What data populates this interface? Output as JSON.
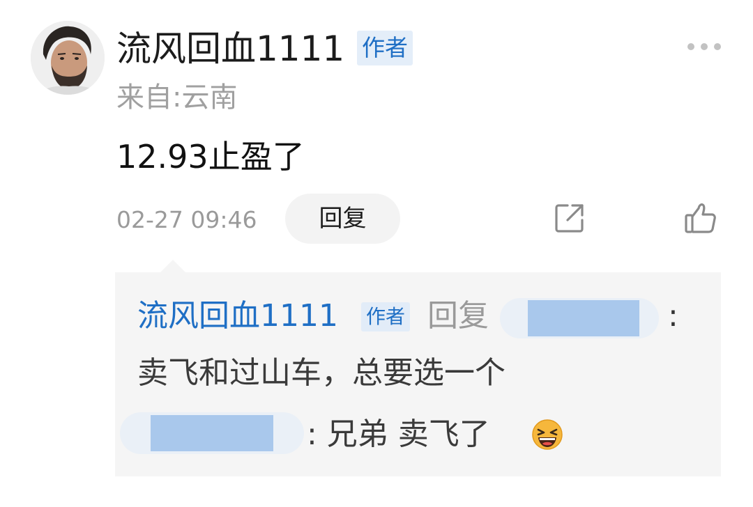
{
  "post": {
    "username": "流风回血1111",
    "author_tag": "作者",
    "location": "来自:云南",
    "content": "12.93止盈了",
    "timestamp": "02-27 09:46",
    "reply_label": "回复"
  },
  "icons": {
    "more": "more-dots-icon",
    "share": "share-icon",
    "like": "thumbs-up-icon",
    "emoji": "laughing-emoji-icon"
  },
  "replies": [
    {
      "username": "流风回血1111",
      "author_tag": "作者",
      "verb": "回复",
      "colon": ":",
      "text": "卖飞和过山车，总要选一个"
    },
    {
      "text": ": 兄弟  卖飞了"
    }
  ],
  "colors": {
    "link_blue": "#1f6fc5",
    "tag_bg": "#e4eef9",
    "reply_box_bg": "#f5f5f5",
    "muted_gray": "#9a9a9a"
  }
}
